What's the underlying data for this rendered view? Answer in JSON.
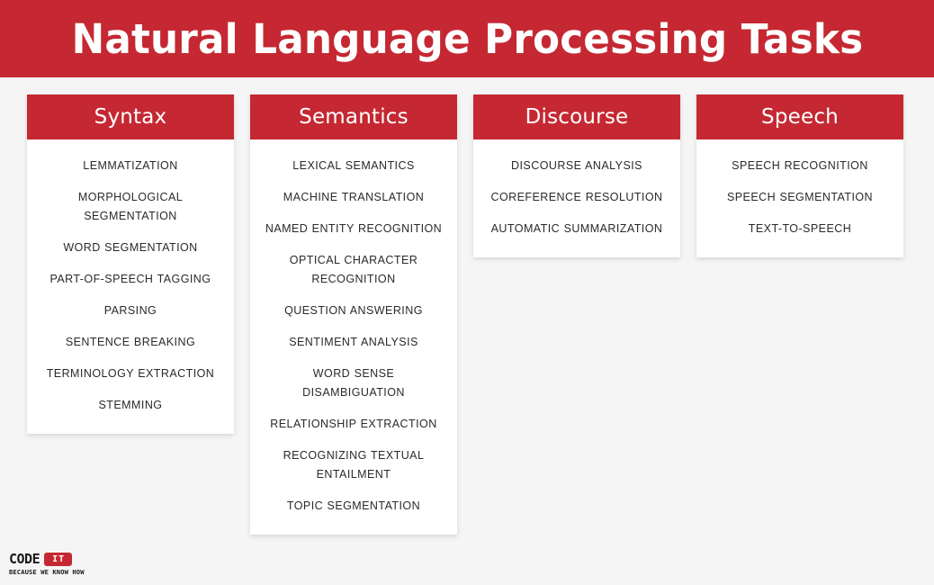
{
  "header": {
    "title": "Natural Language Processing Tasks",
    "background_color": "#c52832",
    "text_color": "#ffffff"
  },
  "page": {
    "background_color": "#f5f5f5"
  },
  "columns": [
    {
      "title": "Syntax",
      "items": [
        "LEMMATIZATION",
        "MORPHOLOGICAL SEGMENTATION",
        "WORD SEGMENTATION",
        "PART-OF-SPEECH TAGGING",
        "PARSING",
        "SENTENCE BREAKING",
        "TERMINOLOGY EXTRACTION",
        "STEMMING"
      ]
    },
    {
      "title": "Semantics",
      "items": [
        "LEXICAL SEMANTICS",
        "MACHINE TRANSLATION",
        "NAMED ENTITY RECOGNITION",
        "OPTICAL CHARACTER RECOGNITION",
        "QUESTION ANSWERING",
        "SENTIMENT ANALYSIS",
        "WORD SENSE DISAMBIGUATION",
        "RELATIONSHIP EXTRACTION",
        "RECOGNIZING TEXTUAL ENTAILMENT",
        "TOPIC SEGMENTATION"
      ]
    },
    {
      "title": "Discourse",
      "items": [
        "DISCOURSE ANALYSIS",
        "COREFERENCE RESOLUTION",
        "AUTOMATIC SUMMARIZATION"
      ]
    },
    {
      "title": "Speech",
      "items": [
        "SPEECH RECOGNITION",
        "SPEECH SEGMENTATION",
        "TEXT-TO-SPEECH"
      ]
    }
  ],
  "logo": {
    "word": "CODE",
    "badge": "IT",
    "tagline": "BECAUSE WE KNOW HOW",
    "badge_color": "#c52832"
  }
}
